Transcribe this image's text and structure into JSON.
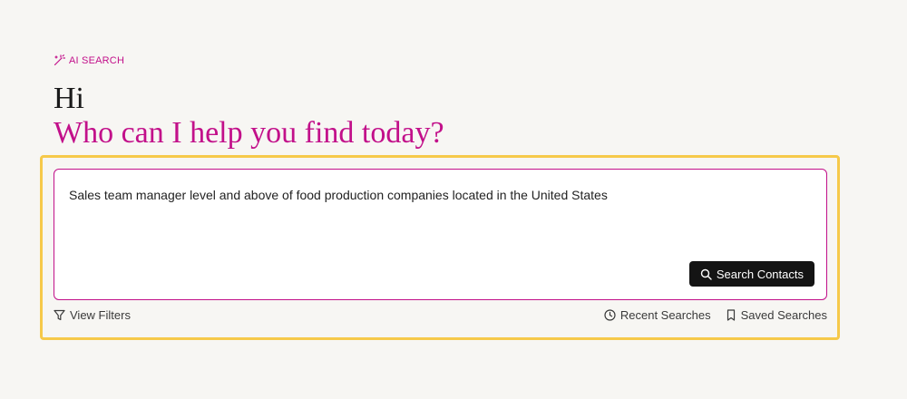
{
  "header": {
    "eyebrow_label": "AI SEARCH",
    "greeting": "Hi",
    "headline": "Who can I help you find today?"
  },
  "search": {
    "query": "Sales team manager level and above of food production companies located in the United States",
    "button_label": "Search Contacts"
  },
  "footer": {
    "view_filters": "View Filters",
    "recent_searches": "Recent Searches",
    "saved_searches": "Saved Searches"
  },
  "colors": {
    "accent": "#c2108a",
    "highlight": "#f6c94a",
    "button_bg": "#141414",
    "background": "#f7f6f3"
  },
  "icons": {
    "eyebrow": "magic-wand-icon",
    "search": "search-icon",
    "filter": "filter-icon",
    "recent": "clock-icon",
    "saved": "bookmark-icon"
  }
}
